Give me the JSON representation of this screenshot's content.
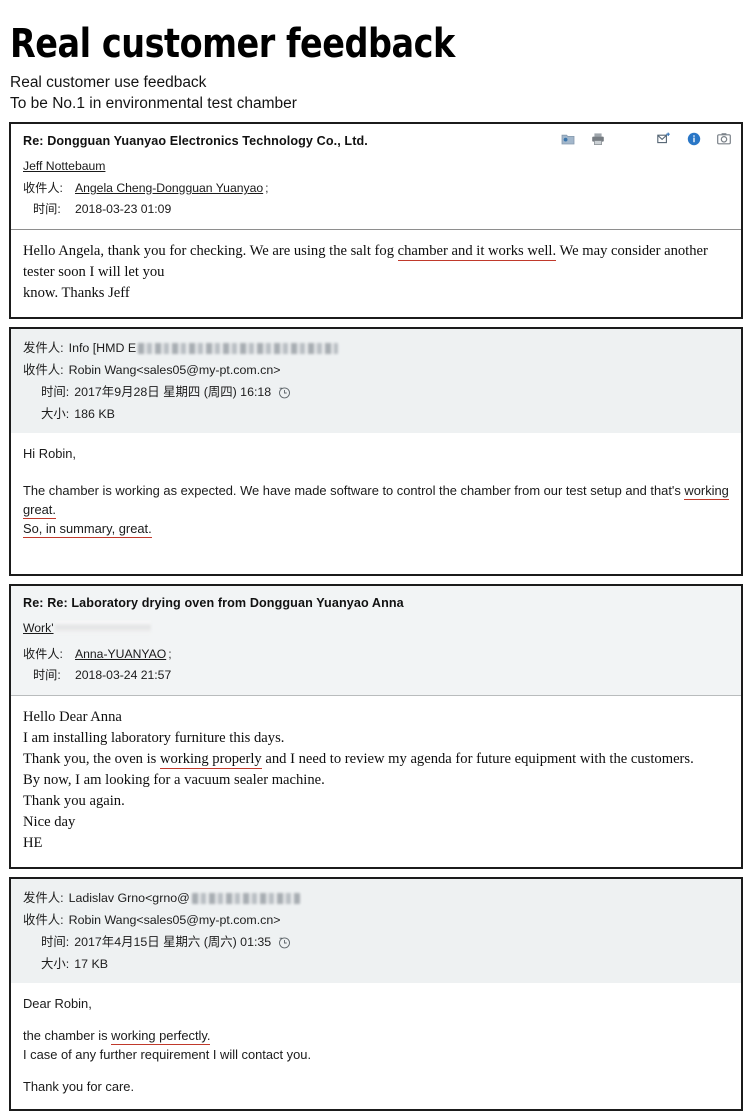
{
  "header": {
    "title": "Real customer feedback",
    "subtitle_line1": "Real customer use feedback",
    "subtitle_line2": "To be No.1 in environmental test chamber"
  },
  "toolbar_icons": [
    {
      "name": "save-attachment-icon",
      "glyph": "folder"
    },
    {
      "name": "print-icon",
      "glyph": "printer"
    },
    {
      "name": "forward-icon",
      "glyph": "forward"
    },
    {
      "name": "info-icon",
      "glyph": "info"
    },
    {
      "name": "camera-icon",
      "glyph": "camera"
    }
  ],
  "colors": {
    "highlight_underline": "#c0392b",
    "card_border": "#1b1b1b",
    "header_tint": "#eef1f2",
    "info_icon_blue": "#1e6fc4"
  },
  "emails": [
    {
      "id": "email-1",
      "subject": "Re: Dongguan Yuanyao Electronics Technology Co., Ltd.",
      "sender_name": "Jeff Nottebaum",
      "to_label": "收件人:",
      "to_value": "Angela Cheng-Dongguan Yuanyao",
      "to_semicolon": ";",
      "time_label": "时间:",
      "time_value": "2018-03-23 01:09",
      "body_lines": [
        {
          "segments": [
            {
              "text": "Hello Angela, thank you for checking. We are using the salt fog ",
              "highlight": false
            },
            {
              "text": "chamber and it works well.",
              "highlight": true
            },
            {
              "text": " We may consider another tester soon I will let you",
              "highlight": false
            }
          ]
        },
        {
          "segments": [
            {
              "text": "know. Thanks Jeff",
              "highlight": false
            }
          ]
        }
      ]
    },
    {
      "id": "email-2",
      "from_label": "发件人:",
      "from_value": "Info [HMD E",
      "from_redacted": true,
      "to_label": "收件人:",
      "to_value": "Robin Wang<sales05@my-pt.com.cn>",
      "time_label": "时间:",
      "time_value": "2017年9月28日 星期四 (周四) 16:18",
      "size_label": "大小:",
      "size_value": "186 KB",
      "body_lines": [
        {
          "segments": [
            {
              "text": "Hi Robin,",
              "highlight": false
            }
          ]
        },
        {
          "gap": true
        },
        {
          "segments": [
            {
              "text": "The chamber is working as expected. We have made software to control the chamber from our test setup and that's ",
              "highlight": false
            },
            {
              "text": "working great.",
              "highlight": true
            }
          ]
        },
        {
          "segments": [
            {
              "text": "So, in summary, great.",
              "highlight": true
            }
          ]
        }
      ]
    },
    {
      "id": "email-3",
      "subject": "Re: Re: Laboratory drying oven from Dongguan Yuanyao Anna",
      "sender_name": "Work'",
      "sender_redacted": true,
      "to_label": "收件人:",
      "to_value": "Anna-YUANYAO",
      "to_semicolon": ";",
      "time_label": "时间:",
      "time_value": "2018-03-24 21:57",
      "body_lines": [
        {
          "segments": [
            {
              "text": "Hello Dear Anna",
              "highlight": false
            }
          ]
        },
        {
          "segments": [
            {
              "text": "I am installing laboratory furniture this days.",
              "highlight": false
            }
          ]
        },
        {
          "segments": [
            {
              "text": "Thank you, the oven is ",
              "highlight": false
            },
            {
              "text": "working properly",
              "highlight": true
            },
            {
              "text": " and I need to review my agenda for future equipment with the customers.",
              "highlight": false
            }
          ]
        },
        {
          "segments": [
            {
              "text": "By now, I am looking  for a vacuum sealer machine.",
              "highlight": false
            }
          ]
        },
        {
          "segments": [
            {
              "text": "Thank you again.",
              "highlight": false
            }
          ]
        },
        {
          "segments": [
            {
              "text": "Nice day",
              "highlight": false
            }
          ]
        },
        {
          "segments": [
            {
              "text": "HE",
              "highlight": false
            }
          ]
        }
      ]
    },
    {
      "id": "email-4",
      "from_label": "发件人:",
      "from_value": "Ladislav Grno<grno@",
      "from_redacted": true,
      "to_label": "收件人:",
      "to_value": "Robin Wang<sales05@my-pt.com.cn>",
      "time_label": "时间:",
      "time_value": "2017年4月15日 星期六 (周六) 01:35",
      "size_label": "大小:",
      "size_value": "17 KB",
      "body_lines": [
        {
          "segments": [
            {
              "text": "Dear Robin,",
              "highlight": false
            }
          ]
        },
        {
          "gap": true
        },
        {
          "segments": [
            {
              "text": "the chamber is ",
              "highlight": false
            },
            {
              "text": "working perfectly.",
              "highlight": true
            }
          ]
        },
        {
          "segments": [
            {
              "text": "I case of any further requirement I will contact you.",
              "highlight": false
            }
          ]
        },
        {
          "gap": true
        },
        {
          "segments": [
            {
              "text": "Thank you for care.",
              "highlight": false
            }
          ]
        }
      ]
    }
  ]
}
